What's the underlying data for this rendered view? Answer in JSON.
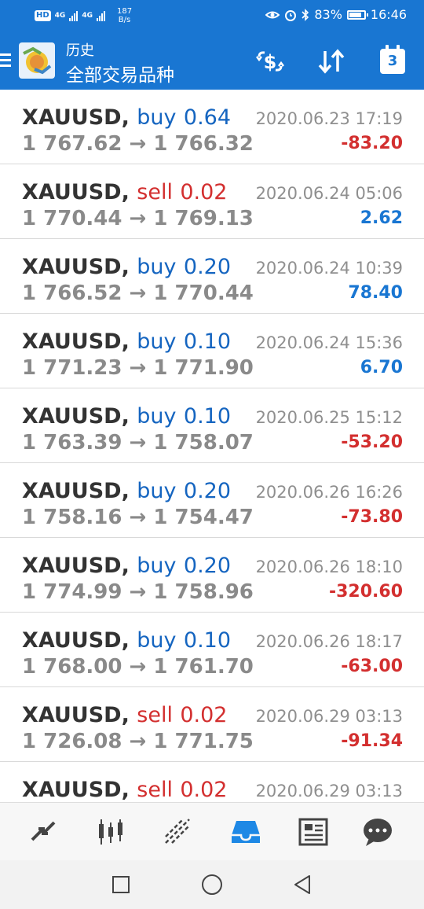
{
  "status_bar": {
    "hd_label": "HD",
    "signal1_label": "4G",
    "signal2_label": "4G",
    "speed_value": "187",
    "speed_unit": "B/s",
    "battery": "83%",
    "battery_level": 0.83,
    "time": "16:46"
  },
  "header": {
    "subtitle": "历史",
    "title": "全部交易品种",
    "calendar_day": "3"
  },
  "colors": {
    "brand": "#1976d2",
    "buy": "#1565c0",
    "sell": "#d32f2f",
    "profit_positive": "#1976d2",
    "profit_negative": "#d32f2f"
  },
  "trades": [
    {
      "symbol": "XAUUSD,",
      "side": "buy",
      "volume": "0.64",
      "open": "1 767.62",
      "arrow": "→",
      "close": "1 766.32",
      "time": "2020.06.23 17:19",
      "profit": "-83.20"
    },
    {
      "symbol": "XAUUSD,",
      "side": "sell",
      "volume": "0.02",
      "open": "1 770.44",
      "arrow": "→",
      "close": "1 769.13",
      "time": "2020.06.24 05:06",
      "profit": "2.62"
    },
    {
      "symbol": "XAUUSD,",
      "side": "buy",
      "volume": "0.20",
      "open": "1 766.52",
      "arrow": "→",
      "close": "1 770.44",
      "time": "2020.06.24 10:39",
      "profit": "78.40"
    },
    {
      "symbol": "XAUUSD,",
      "side": "buy",
      "volume": "0.10",
      "open": "1 771.23",
      "arrow": "→",
      "close": "1 771.90",
      "time": "2020.06.24 15:36",
      "profit": "6.70"
    },
    {
      "symbol": "XAUUSD,",
      "side": "buy",
      "volume": "0.10",
      "open": "1 763.39",
      "arrow": "→",
      "close": "1 758.07",
      "time": "2020.06.25 15:12",
      "profit": "-53.20"
    },
    {
      "symbol": "XAUUSD,",
      "side": "buy",
      "volume": "0.20",
      "open": "1 758.16",
      "arrow": "→",
      "close": "1 754.47",
      "time": "2020.06.26 16:26",
      "profit": "-73.80"
    },
    {
      "symbol": "XAUUSD,",
      "side": "buy",
      "volume": "0.20",
      "open": "1 774.99",
      "arrow": "→",
      "close": "1 758.96",
      "time": "2020.06.26 18:10",
      "profit": "-320.60"
    },
    {
      "symbol": "XAUUSD,",
      "side": "buy",
      "volume": "0.10",
      "open": "1 768.00",
      "arrow": "→",
      "close": "1 761.70",
      "time": "2020.06.26 18:17",
      "profit": "-63.00"
    },
    {
      "symbol": "XAUUSD,",
      "side": "sell",
      "volume": "0.02",
      "open": "1 726.08",
      "arrow": "→",
      "close": "1 771.75",
      "time": "2020.06.29 03:13",
      "profit": "-91.34"
    },
    {
      "symbol": "XAUUSD,",
      "side": "sell",
      "volume": "0.02",
      "open": "",
      "arrow": "",
      "close": "",
      "time": "2020.06.29 03:13",
      "profit": ""
    }
  ],
  "toolbar": {
    "tabs": [
      {
        "icon": "quotes-icon",
        "active": false
      },
      {
        "icon": "chart-icon",
        "active": false
      },
      {
        "icon": "trade-icon",
        "active": false
      },
      {
        "icon": "history-icon",
        "active": true
      },
      {
        "icon": "news-icon",
        "active": false
      },
      {
        "icon": "chat-icon",
        "active": false
      }
    ]
  }
}
